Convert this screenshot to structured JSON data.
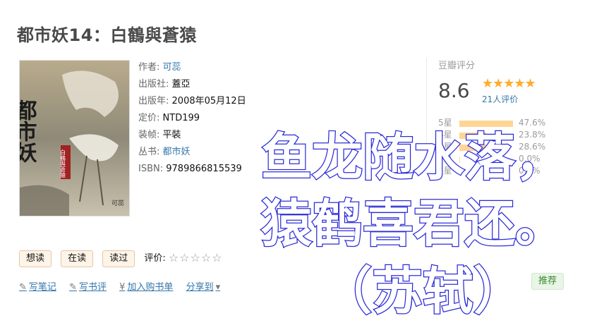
{
  "book": {
    "title": "都市妖14：白鶴與蒼猿",
    "info": [
      {
        "label": "作者:",
        "value": "可蕊",
        "link": true
      },
      {
        "label": "出版社:",
        "value": "蓋亞",
        "link": false
      },
      {
        "label": "出版年:",
        "value": "2008年05月12日",
        "link": false
      },
      {
        "label": "定价:",
        "value": "NTD199",
        "link": false
      },
      {
        "label": "装帧:",
        "value": "平裝",
        "link": false
      },
      {
        "label": "丛书:",
        "value": "都市妖",
        "link": true
      },
      {
        "label": "ISBN:",
        "value": "9789866815539",
        "link": false
      }
    ],
    "cover_text": {
      "main": "都市妖",
      "sub": "白鶴與蒼猿",
      "author": "可蕊"
    }
  },
  "rating": {
    "title": "豆瓣评分",
    "score": "8.6",
    "stars": "★★★★★",
    "star_fraction": 0.86,
    "votes": "21人评价",
    "distribution": [
      {
        "label": "5星",
        "pct": "47.6%",
        "value": 47.6
      },
      {
        "label": "4星",
        "pct": "23.8%",
        "value": 23.8
      },
      {
        "label": "3星",
        "pct": "28.6%",
        "value": 28.6
      },
      {
        "label": "2星",
        "pct": "0.0%",
        "value": 0.0
      },
      {
        "label": "1星",
        "pct": "0.0%",
        "value": 0.0
      }
    ],
    "accent": "#ffac2d"
  },
  "actions": {
    "want": "想读",
    "reading": "在读",
    "read": "读过",
    "eval_label": "评价:",
    "eval_stars": "☆☆☆☆☆"
  },
  "tools": [
    {
      "icon": "pencil-icon",
      "label": "写笔记"
    },
    {
      "icon": "pencil-icon",
      "label": "写书评"
    },
    {
      "icon": "yen-icon",
      "label": "加入购书单"
    },
    {
      "icon": "",
      "label": "分享到"
    }
  ],
  "recommend": "推荐",
  "overlay_poem": {
    "line1": "鱼龙随水落，",
    "line2": "猿鹤喜君还。",
    "line3": "（苏轼）",
    "color": "#2a2ad8"
  }
}
